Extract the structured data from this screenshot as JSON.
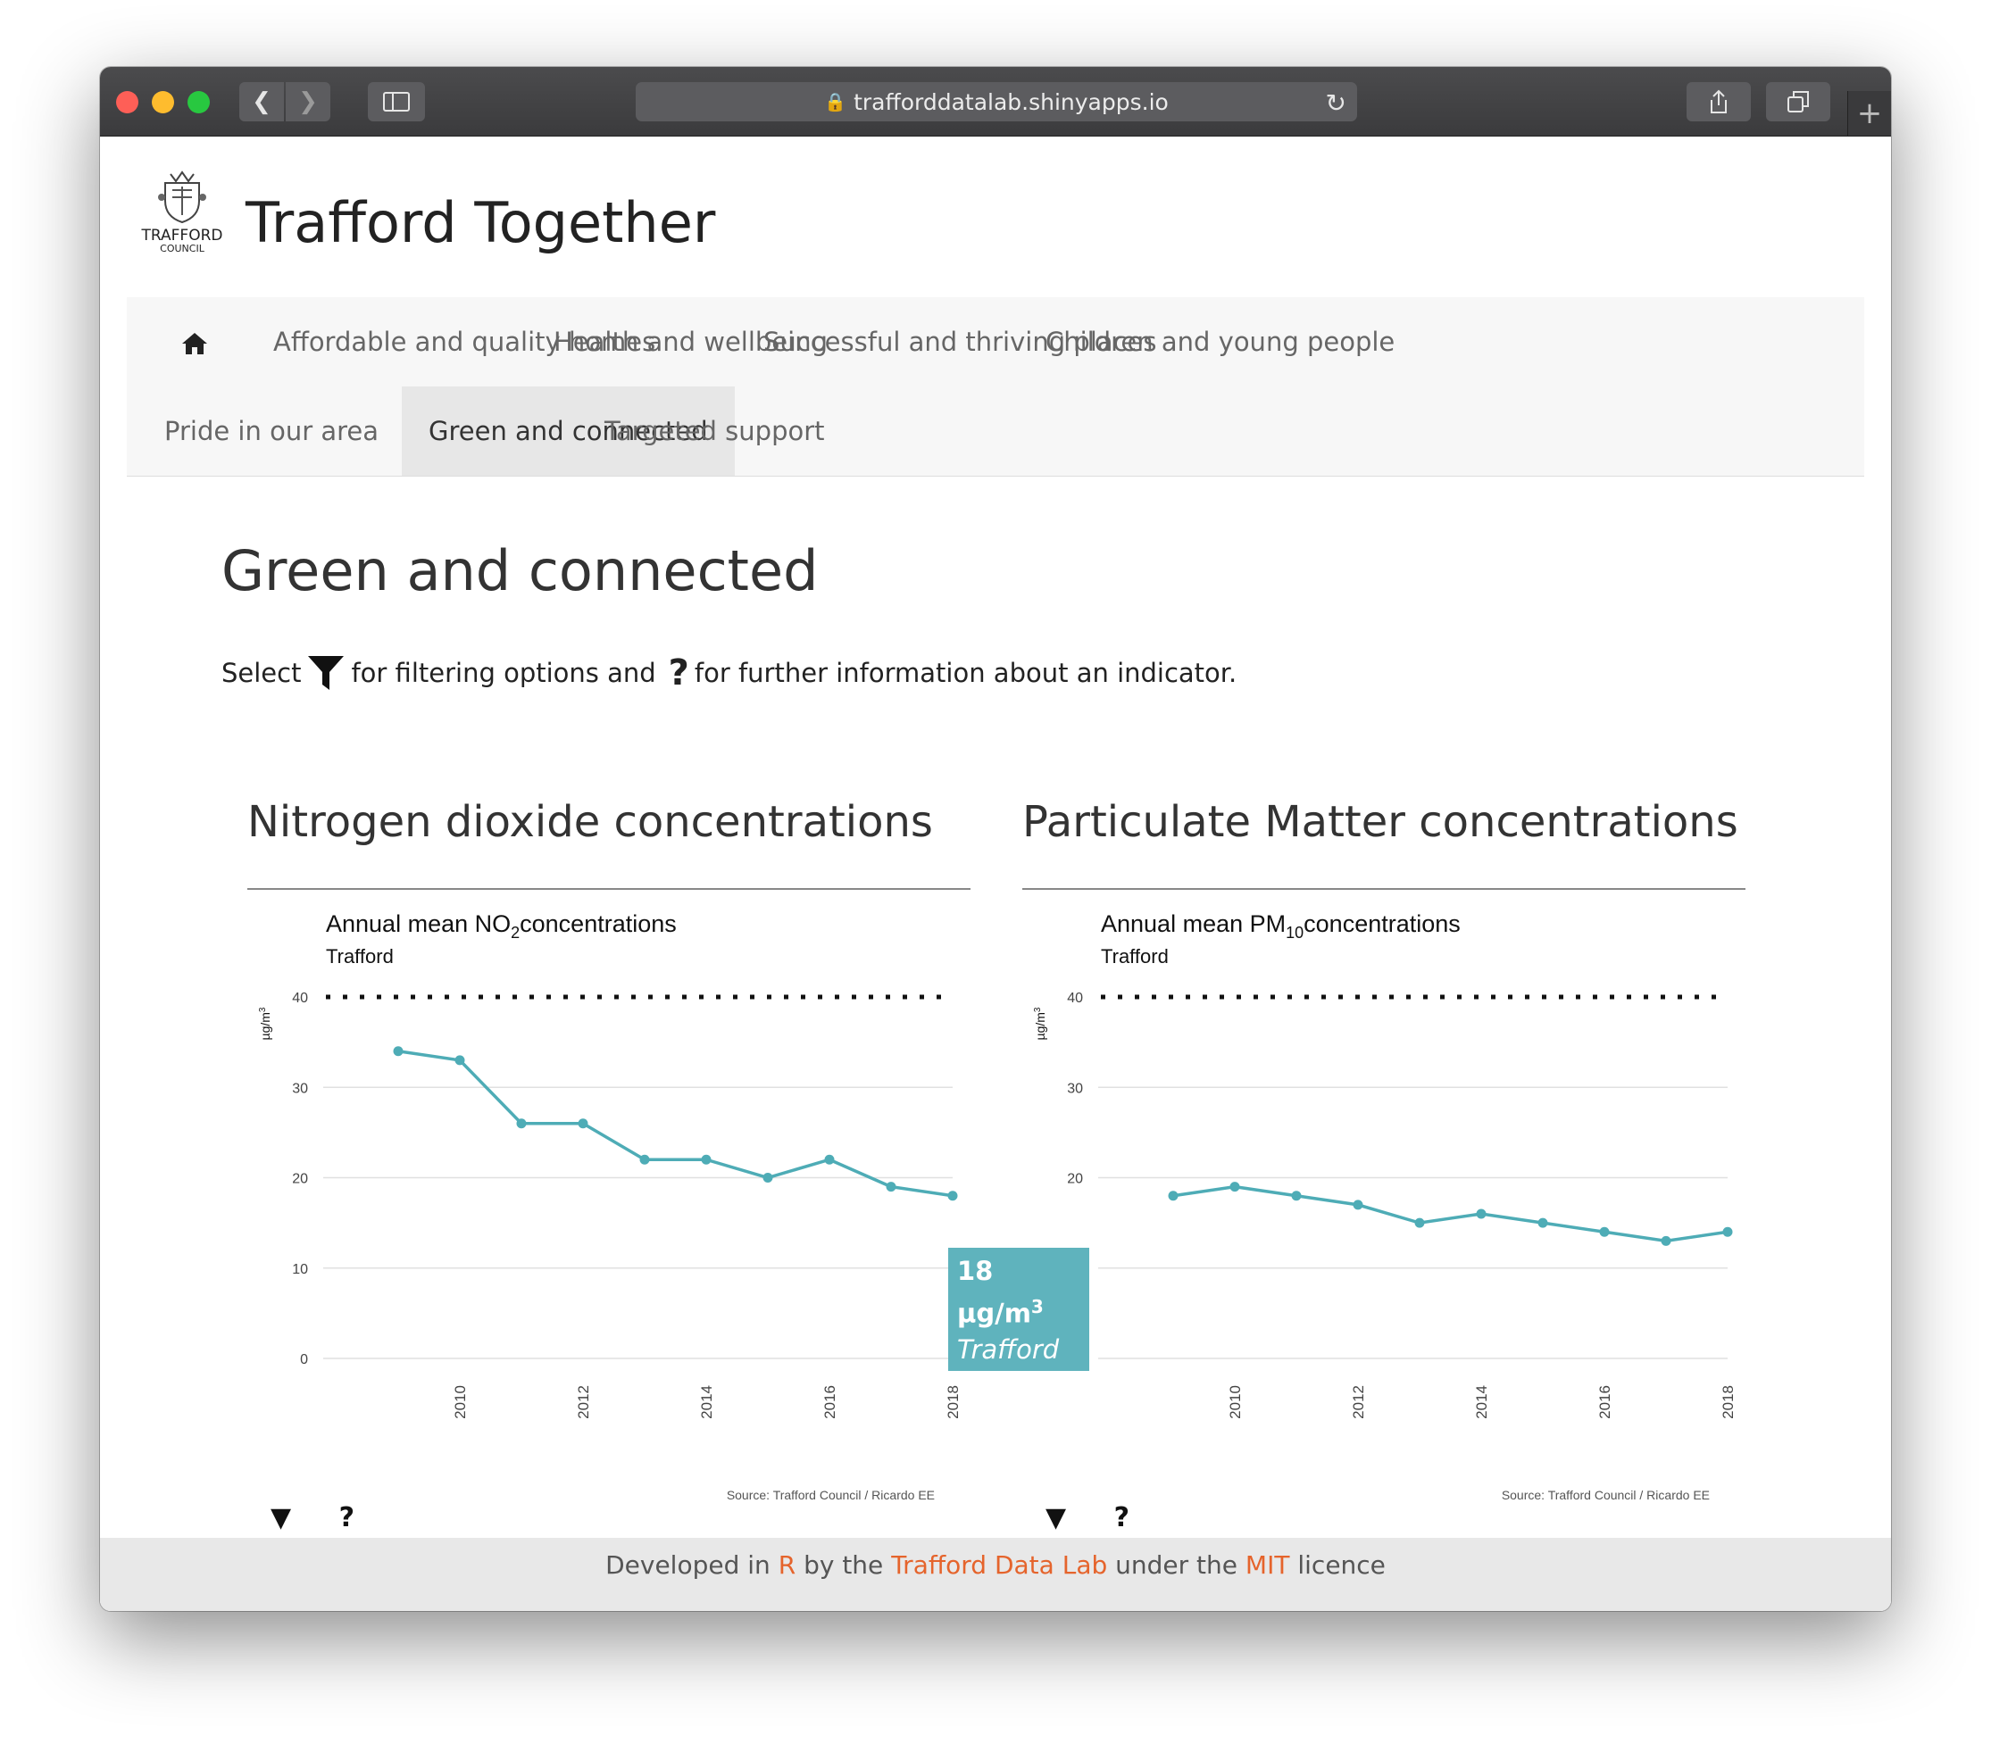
{
  "browser": {
    "url": "trafforddatalab.shinyapps.io"
  },
  "app": {
    "council_logo_text_1": "TRAFFORD",
    "council_logo_text_2": "COUNCIL",
    "title": "Trafford Together"
  },
  "nav": {
    "home_icon": "home-icon",
    "items": [
      "Affordable and quality homes",
      "Health and wellbeing",
      "Successful and thriving places",
      "Children and young people",
      "Pride in our area",
      "Green and connected",
      "Targeted support"
    ],
    "active": "Green and connected"
  },
  "page": {
    "title": "Green and connected",
    "instruction_1": "Select",
    "instruction_2": "for filtering options and",
    "instruction_3": "for further information about an indicator.",
    "filter_icon": "filter-icon",
    "help_icon": "question-icon"
  },
  "panels": [
    {
      "heading": "Nitrogen dioxide concentrations",
      "filter_label": "▼",
      "help_label": "?"
    },
    {
      "heading": "Particulate Matter concentrations",
      "filter_label": "▼",
      "help_label": "?"
    }
  ],
  "chart_data": [
    {
      "type": "line",
      "title_prefix": "Annual mean",
      "title_pollutant": "NO",
      "title_subscript": "2",
      "title_suffix": "concentrations",
      "subtitle": "Trafford",
      "ylabel": "µg/m",
      "ylabel_superscript": "3",
      "ylim": [
        0,
        40
      ],
      "yticks": [
        0,
        10,
        20,
        30,
        40
      ],
      "xticks": [
        2010,
        2012,
        2014,
        2016,
        2018
      ],
      "xlim": [
        2008,
        2018
      ],
      "reference_line": 40,
      "caption": "Source: Trafford Council / Ricardo EE",
      "series": [
        {
          "name": "Trafford",
          "color": "#4eacb6",
          "x": [
            2009,
            2010,
            2011,
            2012,
            2013,
            2014,
            2015,
            2016,
            2017,
            2018
          ],
          "values": [
            34,
            33,
            26,
            26,
            22,
            22,
            20,
            22,
            19,
            18
          ]
        }
      ]
    },
    {
      "type": "line",
      "title_prefix": "Annual mean",
      "title_pollutant": "PM",
      "title_subscript": "10",
      "title_suffix": "concentrations",
      "subtitle": "Trafford",
      "ylabel": "µg/m",
      "ylabel_superscript": "3",
      "ylim": [
        0,
        40
      ],
      "yticks": [
        0,
        10,
        20,
        30,
        40
      ],
      "xticks": [
        2010,
        2012,
        2014,
        2016,
        2018
      ],
      "xlim": [
        2008,
        2018
      ],
      "reference_line": 40,
      "caption": "Source: Trafford Council / Ricardo EE",
      "series": [
        {
          "name": "Trafford",
          "color": "#4eacb6",
          "x": [
            2009,
            2010,
            2011,
            2012,
            2013,
            2014,
            2015,
            2016,
            2017,
            2018
          ],
          "values": [
            18,
            19,
            18,
            17,
            15,
            16,
            15,
            14,
            13,
            14
          ]
        }
      ]
    }
  ],
  "tooltip": {
    "value": "18 µg/m",
    "value_superscript": "3",
    "area": "Trafford",
    "year": "2018"
  },
  "footer": {
    "t1": "Developed in",
    "r": "R",
    "t2": "by the",
    "lab": "Trafford Data Lab",
    "t3": "under the",
    "mit": "MIT",
    "t4": "licence"
  }
}
